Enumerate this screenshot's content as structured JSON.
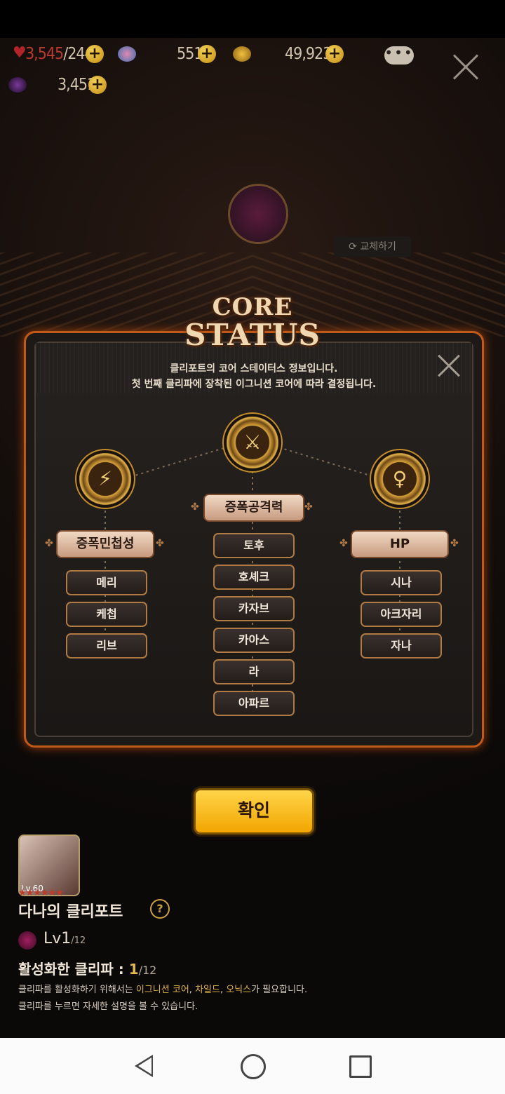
{
  "resources": {
    "stamina": "3,545",
    "stamina_max": "/244",
    "crystal": "551",
    "gold": "49,923",
    "soul": "3,451"
  },
  "swap_label": "교체하기",
  "dialog": {
    "title_line1": "CORE",
    "title_line2": "STATUS",
    "info_line1": "클리포트의 코어 스테이터스 정보입니다.",
    "info_line2": "첫 번째 클리파에 장착된 이그니션 코어에 따라 결정됩니다.",
    "columns": [
      {
        "stat": "증폭민첩성",
        "icon": "lightning-icon",
        "members": [
          "메리",
          "케첩",
          "리브"
        ]
      },
      {
        "stat": "증폭공격력",
        "icon": "crossed-swords-icon",
        "members": [
          "토후",
          "호셰크",
          "카자브",
          "카아스",
          "라",
          "아파르"
        ]
      },
      {
        "stat": "HP",
        "icon": "human-body-icon",
        "members": [
          "시나",
          "아크자리",
          "자나"
        ]
      }
    ]
  },
  "confirm_label": "확인",
  "character": {
    "level_badge": "Lv.60",
    "stars": "★★★★★★",
    "name": "다나의 클리포트",
    "help": "?",
    "core_level": "Lv1",
    "core_level_max": "/12",
    "active_label": "활성화한 클리파 : ",
    "active_count": "1",
    "active_total": "/12",
    "desc1_prefix": "클리파를 활성화하기 위해서는 ",
    "desc1_item1": "이그니션 코어",
    "desc1_sep1": ", ",
    "desc1_item2": "차일드",
    "desc1_sep2": ", ",
    "desc1_item3": "오닉스",
    "desc1_suffix": "가 필요합니다.",
    "desc2": "클리파를 누르면 자세한 설명을 볼 수 있습니다."
  },
  "colors": {
    "accent": "#f2a500",
    "frame": "#c05a1a",
    "highlight": "#e0b347"
  }
}
